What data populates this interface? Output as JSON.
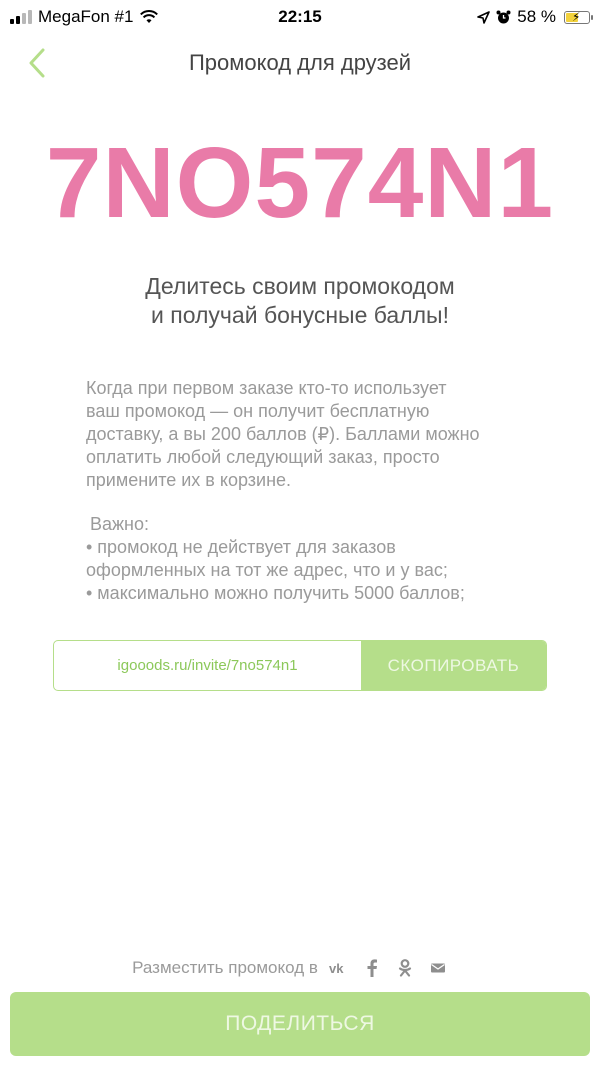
{
  "status_bar": {
    "carrier": "MegaFon #1",
    "time": "22:15",
    "battery_percent": "58 %",
    "battery_level": 0.58
  },
  "nav": {
    "title": "Промокод для друзей"
  },
  "promo": {
    "code": "7NO574N1",
    "headline_line1": "Делитесь своим промокодом",
    "headline_line2": "и получай бонусные баллы!",
    "description": "Когда при первом заказе кто-то использует\nваш промокод — он получит бесплатную\nдоставку, а вы 200 баллов (₽). Баллами можно\nоплатить любой следующий заказ, просто\nпримените их в корзине.",
    "important_title": "Важно:",
    "important_items": [
      "• промокод не действует для заказов",
      "оформленных на тот же адрес, что и у вас;",
      "• максимально можно получить 5000 баллов;"
    ]
  },
  "link": {
    "url": "igooods.ru/invite/7no574n1",
    "copy_label": "СКОПИРОВАТЬ"
  },
  "share": {
    "prompt": "Разместить промокод в",
    "icons": [
      "vk-icon",
      "facebook-icon",
      "odnoklassniki-icon",
      "mail-icon"
    ],
    "button_label": "ПОДЕЛИТЬСЯ"
  },
  "colors": {
    "accent_green": "#b5de8a",
    "promo_pink": "#e97ba8"
  }
}
